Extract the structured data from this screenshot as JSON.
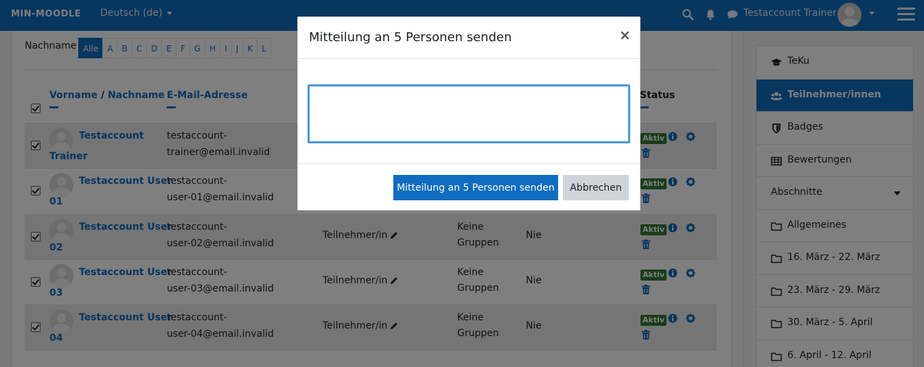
{
  "navbar": {
    "brand": "MIN-MOODLE",
    "language": "Deutsch (de)",
    "user_name": "Testaccount Trainer",
    "icons": [
      "search-icon",
      "bell-icon",
      "chat-icon",
      "chevron-down-icon",
      "hamburger-icon"
    ]
  },
  "filter": {
    "label": "Nachname",
    "letters": [
      "Alle",
      "A",
      "B",
      "C",
      "D",
      "E",
      "F",
      "G",
      "H",
      "I",
      "J",
      "K",
      "L"
    ],
    "active": "Alle"
  },
  "table": {
    "header_firstname": "Vorname",
    "header_separator": "/",
    "header_lastname": "Nachname",
    "header_email": "E-Mail-Adresse",
    "header_status": "Status",
    "rows": [
      {
        "name1": "Testaccount",
        "name2": "Trainer",
        "email1": "testaccount-",
        "email2": "trainer@email.invalid",
        "role": "",
        "group1": "",
        "group2": "",
        "access": "",
        "status": "Aktiv"
      },
      {
        "name1": "Testaccount User",
        "name2": "01",
        "email1": "testaccount-",
        "email2": "user-01@email.invalid",
        "role": "",
        "group1": "",
        "group2": "",
        "access": "",
        "status": "Aktiv"
      },
      {
        "name1": "Testaccount User",
        "name2": "02",
        "email1": "testaccount-",
        "email2": "user-02@email.invalid",
        "role": "Teilnehmer/in",
        "group1": "Keine",
        "group2": "Gruppen",
        "access": "Nie",
        "status": "Aktiv"
      },
      {
        "name1": "Testaccount User",
        "name2": "03",
        "email1": "testaccount-",
        "email2": "user-03@email.invalid",
        "role": "Teilnehmer/in",
        "group1": "Keine",
        "group2": "Gruppen",
        "access": "Nie",
        "status": "Aktiv"
      },
      {
        "name1": "Testaccount User",
        "name2": "04",
        "email1": "testaccount-",
        "email2": "user-04@email.invalid",
        "role": "Teilnehmer/in",
        "group1": "Keine",
        "group2": "Gruppen",
        "access": "Nie",
        "status": "Aktiv"
      }
    ]
  },
  "drawer": {
    "items": [
      {
        "label": "TeKu",
        "icon": "graduation-cap-icon"
      },
      {
        "label": "Teilnehmer/innen",
        "icon": "users-icon",
        "active": true
      },
      {
        "label": "Badges",
        "icon": "shield-icon"
      },
      {
        "label": "Bewertungen",
        "icon": "table-icon"
      },
      {
        "label": "Abschnitte",
        "icon": "",
        "dropdown": true
      },
      {
        "label": "Allgemeines",
        "icon": "folder-icon"
      },
      {
        "label": "16. März - 22. März",
        "icon": "folder-icon"
      },
      {
        "label": "23. März - 29. März",
        "icon": "folder-icon"
      },
      {
        "label": "30. März - 5. April",
        "icon": "folder-icon"
      },
      {
        "label": "6. April - 12. April",
        "icon": "folder-icon"
      }
    ]
  },
  "modal": {
    "title": "Mitteilung an 5 Personen senden",
    "close_label": "×",
    "message_value": "",
    "send_label": "Mitteilung an 5 Personen senden",
    "cancel_label": "Abbrechen"
  },
  "colors": {
    "brand": "#0f6cbf",
    "active_badge": "#357a32",
    "focus_border": "#4a97d5"
  }
}
